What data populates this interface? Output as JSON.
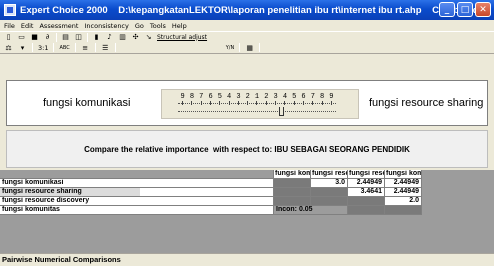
{
  "window": {
    "title": "Expert Choice 2000    D:\\kepangkatanLEKTOR\\laporan penelitian ibu rt\\internet ibu rt.ahp    Combined",
    "minimize": "_",
    "maximize": "□",
    "close": "✕"
  },
  "menu": {
    "items": [
      "File",
      "Edit",
      "Assessment",
      "Inconsistency",
      "Go",
      "Tools",
      "Help"
    ]
  },
  "toolbar": {
    "structural_adjust": "Structural adjust",
    "view_label": "3:1",
    "abc_label": "ABC",
    "ymn_label": "Y/N"
  },
  "comparison": {
    "left_element": "fungsi komunikasi",
    "right_element": "fungsi resource sharing",
    "scale": [
      "9",
      "8",
      "7",
      "6",
      "5",
      "4",
      "3",
      "2",
      "1",
      "2",
      "3",
      "4",
      "5",
      "6",
      "7",
      "8",
      "9"
    ],
    "thumb_position_value": 3
  },
  "banner": {
    "text": "Compare the relative importance  with respect to: IBU SEBAGAI SEORANG PENDIDIK"
  },
  "matrix": {
    "headers": [
      "fungsi kom",
      "fungsi resc",
      "fungsi resc",
      "fungsi kom"
    ],
    "rows": [
      {
        "label": "fungsi komunikasi",
        "values": [
          "",
          "3.0",
          "2.44949",
          "2.44949"
        ]
      },
      {
        "label": "fungsi resource sharing",
        "values": [
          "",
          "",
          "3.4641",
          "2.44949"
        ]
      },
      {
        "label": "fungsi resource discovery",
        "values": [
          "",
          "",
          "",
          "2.0"
        ]
      },
      {
        "label": "fungsi komunitas",
        "values": [
          "Incon: 0.05",
          "",
          "",
          ""
        ]
      }
    ]
  },
  "status": {
    "text": "Pairwise Numerical Comparisons"
  }
}
